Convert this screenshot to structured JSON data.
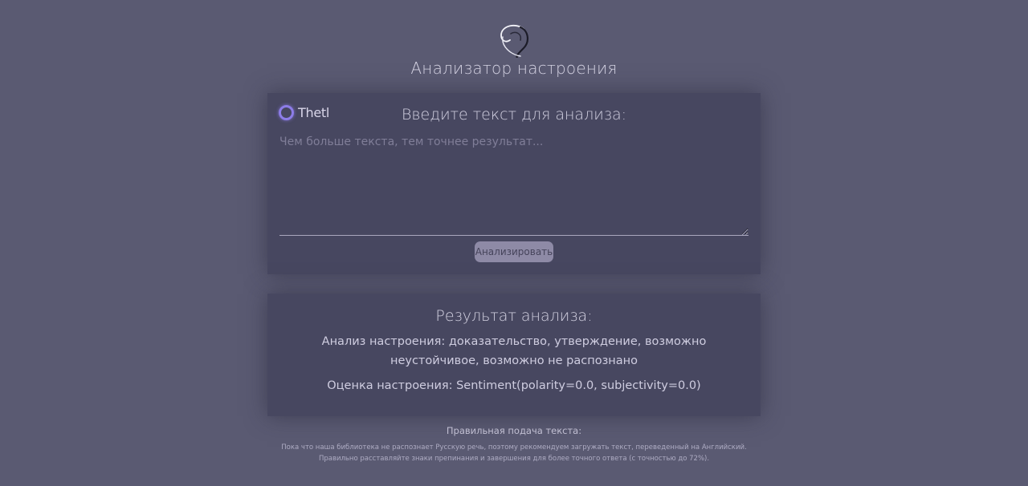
{
  "header": {
    "logo_icon": "abstract-swirl-logo-icon",
    "title": "Анализатор настроения"
  },
  "input_card": {
    "badge_icon": "ring-icon",
    "badge_text": "Thetl",
    "heading": "Введите текст для анализа:",
    "textarea": {
      "value": "",
      "placeholder": "Чем больше текста, тем точнее результат..."
    },
    "analyze_label": "Анализировать"
  },
  "result_card": {
    "heading": "Результат анализа:",
    "mood_text": "Анализ настроения: доказательство, утверждение, возможно неустойчивое, возможно не распознано",
    "score_text": "Оценка настроения: Sentiment(polarity=0.0, subjectivity=0.0)"
  },
  "footer": {
    "title": "Правильная подача текста:",
    "lines": [
      "Пока что наша библиотека не распознает Русскую речь, поэтому рекомендуем загружать текст, переведенный на Английский.",
      "Правильно расставляйте знаки препинания и завершения для более точного ответа (с точностью до 72%)."
    ]
  },
  "colors": {
    "page_background": "#5a5a72",
    "card_background": "#474760",
    "button_background": "#8e8aa6",
    "badge_ring": "#8d7de8"
  }
}
